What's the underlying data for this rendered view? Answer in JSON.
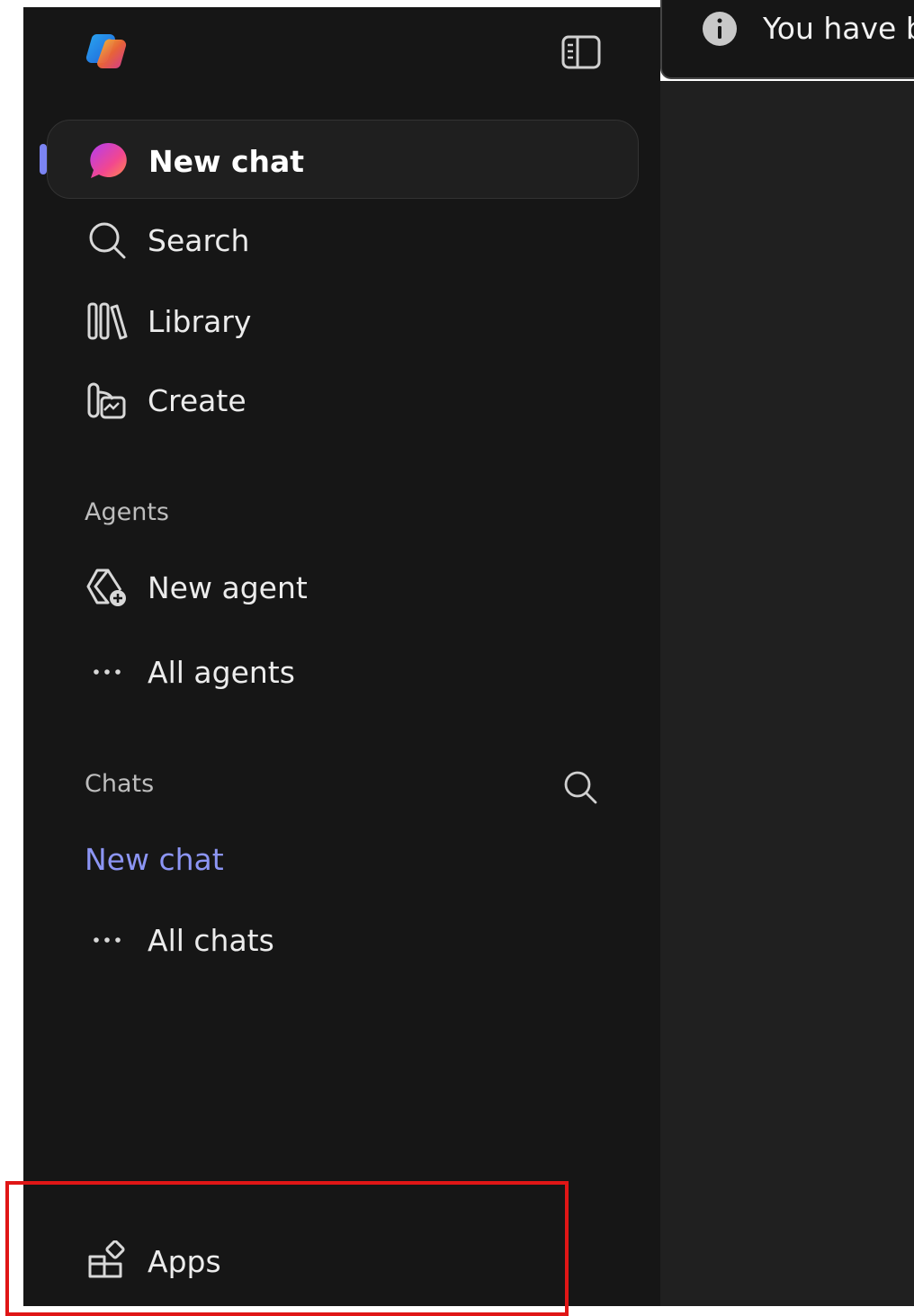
{
  "notice": {
    "text": "You have b",
    "icon": "info-icon"
  },
  "header": {
    "logo_icon": "copilot-logo-icon",
    "toggle_icon": "sidebar-toggle-icon"
  },
  "nav": {
    "new_chat": {
      "label": "New chat",
      "icon": "new-chat-bubble-icon",
      "active": true
    },
    "search": {
      "label": "Search",
      "icon": "search-icon"
    },
    "library": {
      "label": "Library",
      "icon": "library-icon"
    },
    "create": {
      "label": "Create",
      "icon": "create-icon"
    }
  },
  "agents": {
    "section_label": "Agents",
    "new_agent": {
      "label": "New agent",
      "icon": "new-agent-icon"
    },
    "all_agents": {
      "label": "All agents",
      "icon": "more-horizontal-icon"
    }
  },
  "chats": {
    "section_label": "Chats",
    "search_icon": "search-icon",
    "recent": [
      "New chat"
    ],
    "all_chats": {
      "label": "All chats",
      "icon": "more-horizontal-icon"
    }
  },
  "footer": {
    "apps": {
      "label": "Apps",
      "icon": "apps-icon"
    }
  },
  "colors": {
    "sidebar_bg": "#161616",
    "main_bg": "#202020",
    "accent": "#8c95f4",
    "highlight": "#e01616"
  }
}
